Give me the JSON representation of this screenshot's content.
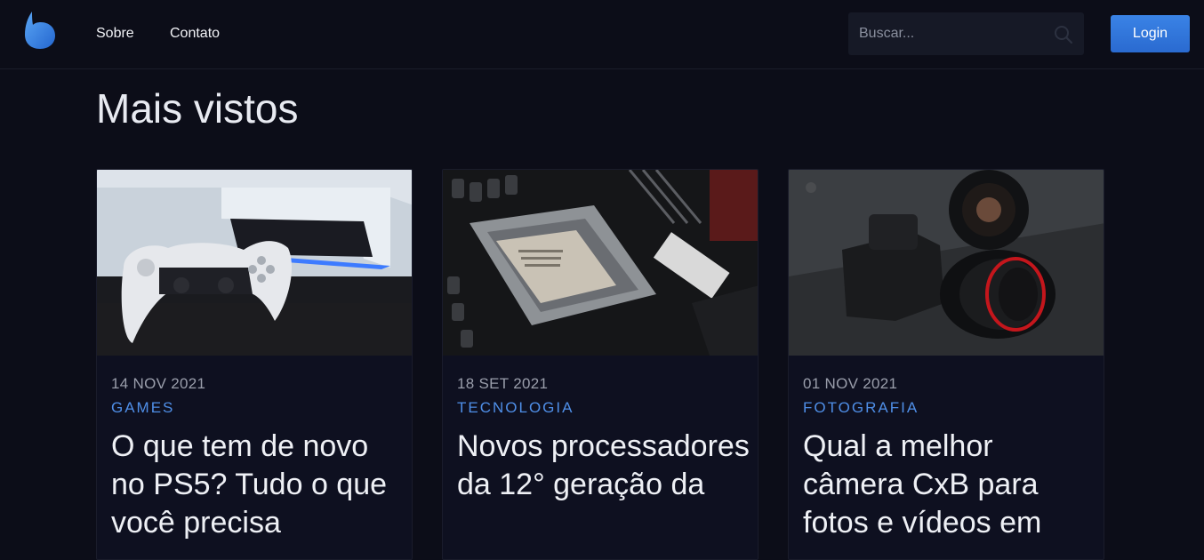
{
  "header": {
    "nav": [
      {
        "label": "Sobre"
      },
      {
        "label": "Contato"
      }
    ],
    "search": {
      "placeholder": "Buscar..."
    },
    "login_label": "Login",
    "icons": {
      "logo": "brand-logo",
      "search": "search-icon"
    }
  },
  "main": {
    "section_title": "Mais vistos",
    "cards": [
      {
        "date": "14 NOV 2021",
        "category": "GAMES",
        "title": "O que tem de novo no PS5? Tudo o que você precisa",
        "image": "ps5-controller-console-photo"
      },
      {
        "date": "18 SET 2021",
        "category": "TECNOLOGIA",
        "title": "Novos processadores da 12° geração da",
        "image": "cpu-motherboard-photo"
      },
      {
        "date": "01 NOV 2021",
        "category": "FOTOGRAFIA",
        "title": "Qual a melhor câmera CxB para fotos e vídeos em",
        "image": "dslr-camera-lens-photo"
      }
    ]
  },
  "colors": {
    "background": "#0c0d18",
    "accent": "#2f74dc",
    "category": "#4f8fe8"
  }
}
